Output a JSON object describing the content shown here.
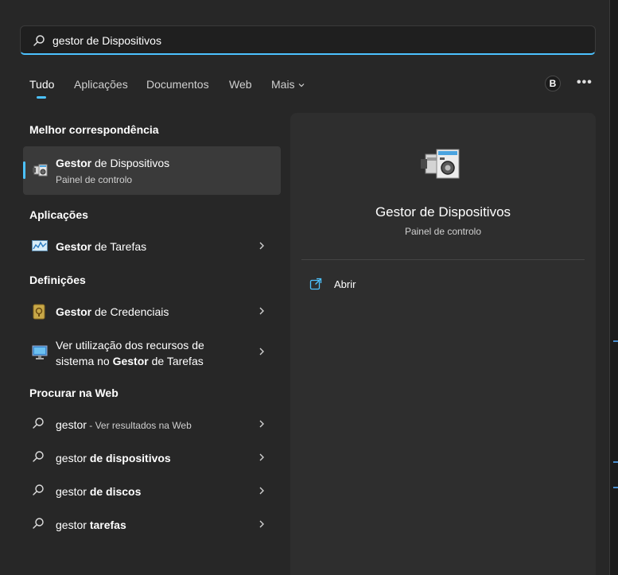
{
  "search": {
    "value": "gestor de Dispositivos"
  },
  "tabs": [
    {
      "label": "Tudo",
      "active": true
    },
    {
      "label": "Aplicações"
    },
    {
      "label": "Documentos"
    },
    {
      "label": "Web"
    },
    {
      "label": "Mais"
    }
  ],
  "account": {
    "initial": "B"
  },
  "more_options": "•••",
  "sections": {
    "best_match": "Melhor correspondência",
    "apps": "Aplicações",
    "settings": "Definições",
    "web": "Procurar na Web"
  },
  "best_match": {
    "title_bold": "Gestor",
    "title_rest": " de Dispositivos",
    "subtitle": "Painel de controlo",
    "icon": "device-manager-icon"
  },
  "apps": [
    {
      "bold": "Gestor",
      "rest": " de Tarefas",
      "icon": "task-manager-icon"
    }
  ],
  "settings": [
    {
      "bold": "Gestor",
      "rest": " de Credenciais",
      "icon": "credential-manager-icon"
    },
    {
      "line1": "Ver utilização dos recursos de",
      "line2_pre": "sistema no ",
      "line2_bold": "Gestor",
      "line2_post": " de Tarefas",
      "icon": "monitor-icon"
    }
  ],
  "web": [
    {
      "pre": "gestor",
      "small": " - Ver resultados na Web",
      "bold": ""
    },
    {
      "pre": "gestor ",
      "small": "",
      "bold": "de dispositivos"
    },
    {
      "pre": "gestor ",
      "small": "",
      "bold": "de discos"
    },
    {
      "pre": "gestor ",
      "small": "",
      "bold": "tarefas"
    }
  ],
  "detail": {
    "title": "Gestor de Dispositivos",
    "subtitle": "Painel de controlo",
    "action": "Abrir"
  },
  "colors": {
    "accent": "#4cc2ff",
    "background": "#272727",
    "detail_bg": "#2e2e2e"
  }
}
